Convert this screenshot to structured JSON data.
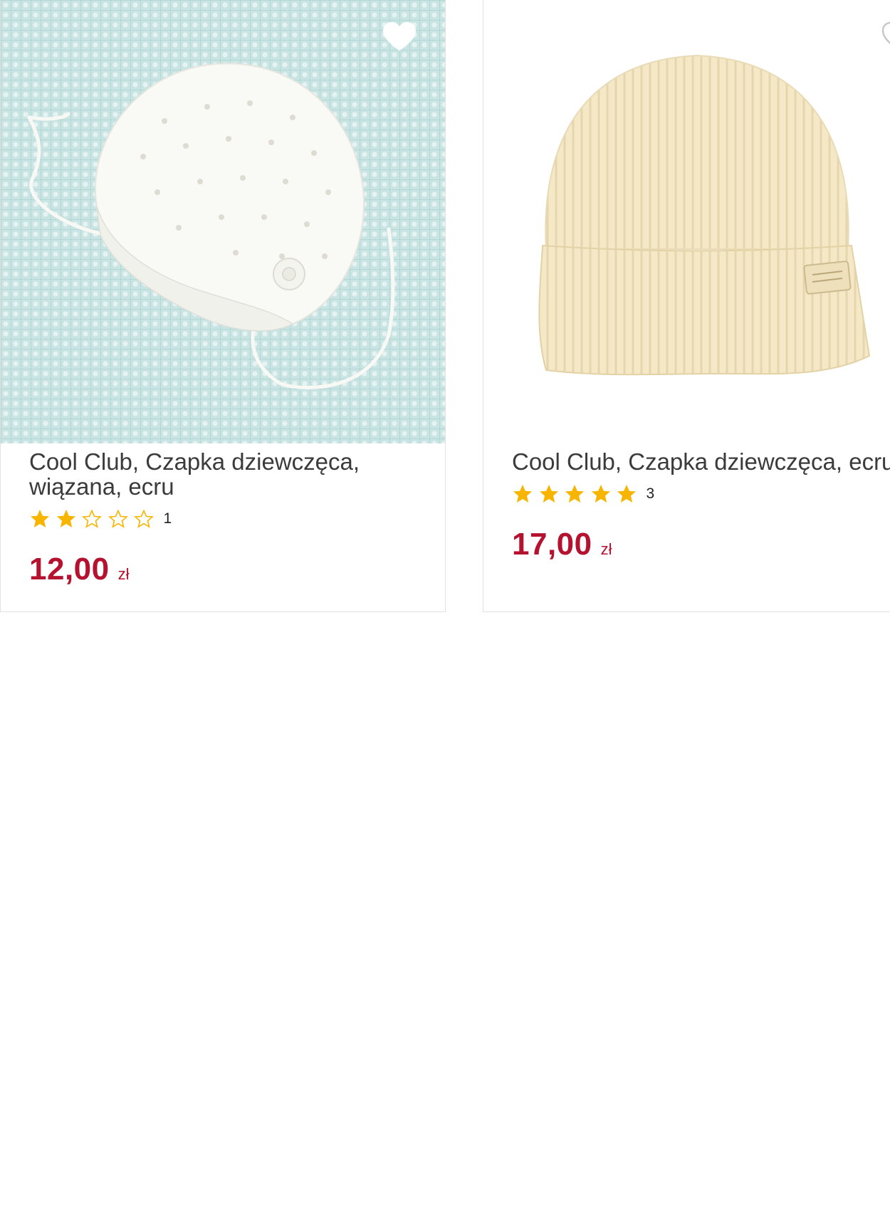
{
  "colors": {
    "price": "#b51230",
    "star_filled": "#f7b500",
    "star_empty_outline": "#f7b500",
    "title": "#3b3b3b",
    "card_border": "#e2e2e2"
  },
  "products": [
    {
      "title": "Cool Club, Czapka dziewczęca, wiązana, ecru",
      "rating": 2,
      "rating_max": 5,
      "rating_count": "1",
      "price": "12,00",
      "currency": "zł",
      "image": "white-knitted-baby-bonnet-on-mint-waffle-blanket",
      "favorite_icon": "heart-icon"
    },
    {
      "title": "Cool Club, Czapka dziewczęca, ecru",
      "rating": 5,
      "rating_max": 5,
      "rating_count": "3",
      "price": "17,00",
      "currency": "zł",
      "image": "cream-ribbed-beanie-with-label",
      "favorite_icon": "heart-icon"
    }
  ]
}
